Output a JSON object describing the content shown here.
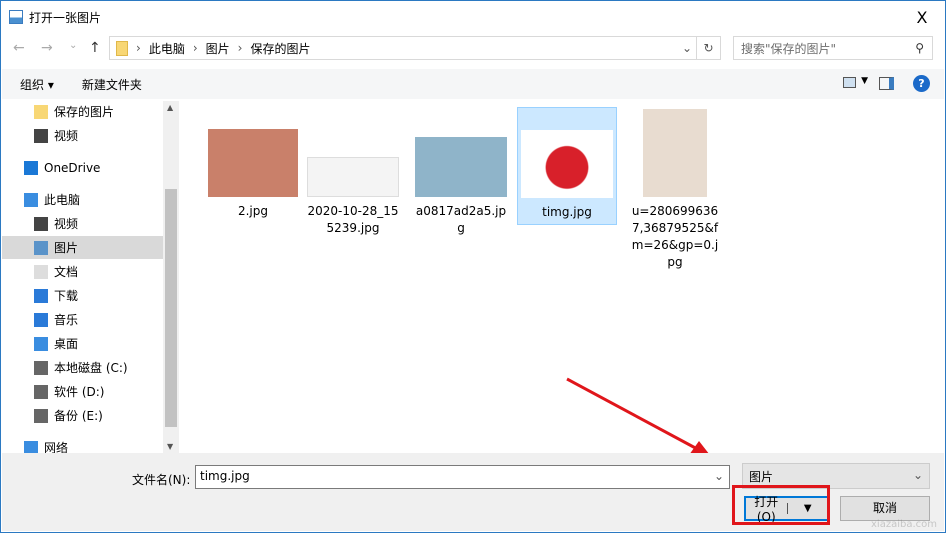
{
  "window": {
    "title": "打开一张图片",
    "close": "X"
  },
  "nav": {
    "back": "←",
    "forward": "→",
    "recent": "⌄",
    "up": "↑",
    "breadcrumb": [
      "此电脑",
      "图片",
      "保存的图片"
    ],
    "refresh": "↻",
    "search_placeholder": "搜索\"保存的图片\""
  },
  "toolbar": {
    "organize": "组织 ▾",
    "new_folder": "新建文件夹",
    "help": "?"
  },
  "sidebar": [
    {
      "label": "保存的图片",
      "icon": "folder-icon"
    },
    {
      "label": "视频",
      "icon": "video-icon"
    },
    {
      "label": "OneDrive",
      "icon": "cloud-icon"
    },
    {
      "label": "此电脑",
      "icon": "computer-icon"
    },
    {
      "label": "视频",
      "icon": "video-icon"
    },
    {
      "label": "图片",
      "icon": "pictures-icon",
      "selected": true
    },
    {
      "label": "文档",
      "icon": "document-icon"
    },
    {
      "label": "下载",
      "icon": "download-icon"
    },
    {
      "label": "音乐",
      "icon": "music-icon"
    },
    {
      "label": "桌面",
      "icon": "desktop-icon"
    },
    {
      "label": "本地磁盘 (C:)",
      "icon": "drive-icon"
    },
    {
      "label": "软件 (D:)",
      "icon": "drive-icon"
    },
    {
      "label": "备份 (E:)",
      "icon": "drive-icon"
    },
    {
      "label": "网络",
      "icon": "network-icon"
    }
  ],
  "files": [
    {
      "name": "2.jpg",
      "color": "#c9806a"
    },
    {
      "name": "2020-10-28_155239.jpg",
      "color": "#f4f4f4"
    },
    {
      "name": "a0817ad2a5.jpg",
      "color": "#8fb4c9"
    },
    {
      "name": "timg.jpg",
      "color": "#d8202a",
      "selected": true
    },
    {
      "name": "u=2806996367,36879525&fm=26&gp=0.jpg",
      "color": "#e8dcd0"
    }
  ],
  "bottom": {
    "filename_label": "文件名(N):",
    "filename_value": "timg.jpg",
    "filetype": "图片",
    "open": "打开(O)",
    "cancel": "取消"
  },
  "watermark": "xiazaiba.com"
}
